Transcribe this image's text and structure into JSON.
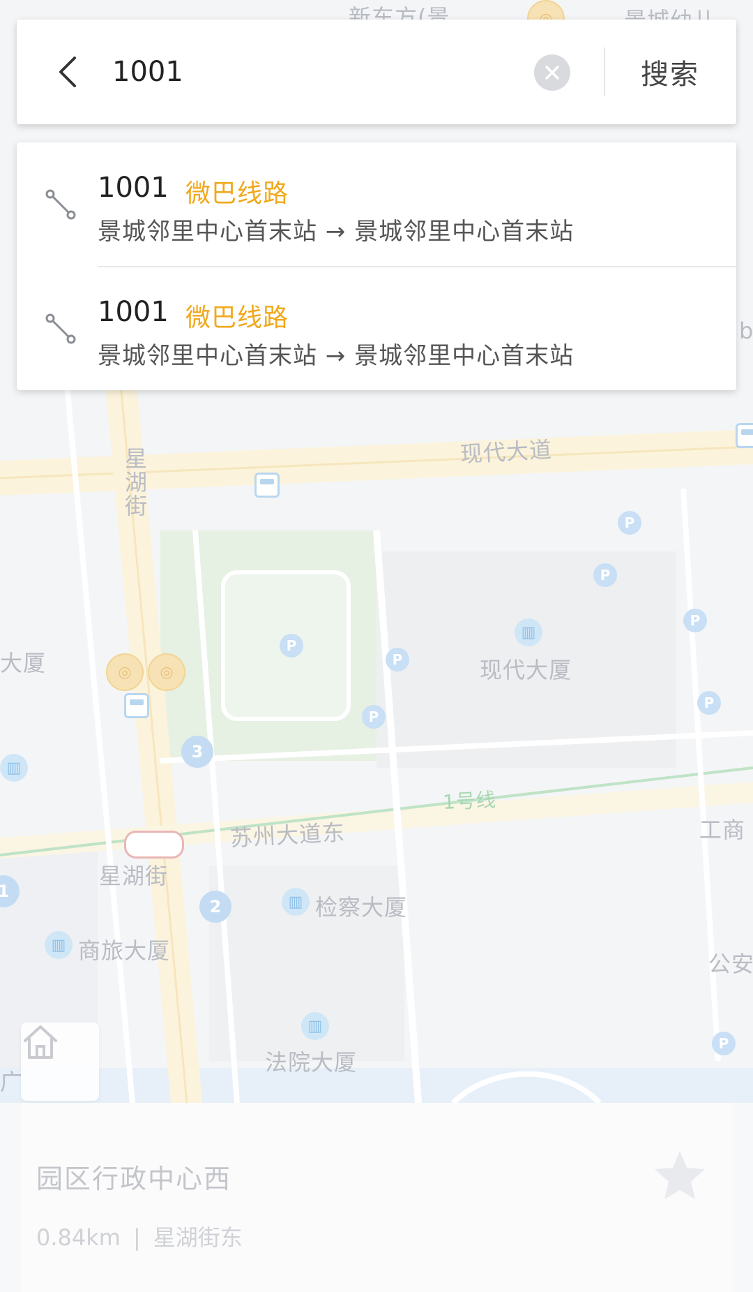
{
  "search": {
    "query": "1001",
    "search_label": "搜索"
  },
  "results": [
    {
      "line": "1001",
      "tag": "微巴线路",
      "route": "景城邻里中心首末站 → 景城邻里中心首末站"
    },
    {
      "line": "1001",
      "tag": "微巴线路",
      "route": "景城邻里中心首末站 → 景城邻里中心首末站"
    }
  ],
  "map": {
    "labels": {
      "top_road": "新东方(景",
      "top_right": "景城幼儿",
      "modern_avenue": "现代大道",
      "xinghu_street_vertical": "星湖街",
      "left_building": "大厦",
      "modern_building": "现代大厦",
      "metro_line": "1号线",
      "suzhou_avenue_east": "苏州大道东",
      "icbc": "工商",
      "xinghu_street_station": "星湖街",
      "procuratorate_building": "检察大厦",
      "business_travel_building": "商旅大厦",
      "public_security": "公安",
      "court_building": "法院大厦",
      "left_edge_guang": "广",
      "right_edge_b": "b"
    },
    "exit_numbers": [
      "3",
      "2",
      "1"
    ],
    "parking_letter": "P"
  },
  "bottom_panel": {
    "place_name": "园区行政中心西",
    "distance": "0.84km",
    "separator": "|",
    "street": "星湖街东"
  },
  "colors": {
    "accent_tag": "#f0a81c",
    "map_background": "#f4f5f7",
    "metro_line": "#a7d7b1"
  },
  "icons": {
    "back": "chevron-left-icon",
    "clear": "clear-circle-icon",
    "route": "route-icon",
    "home": "home-icon",
    "star": "star-icon"
  }
}
